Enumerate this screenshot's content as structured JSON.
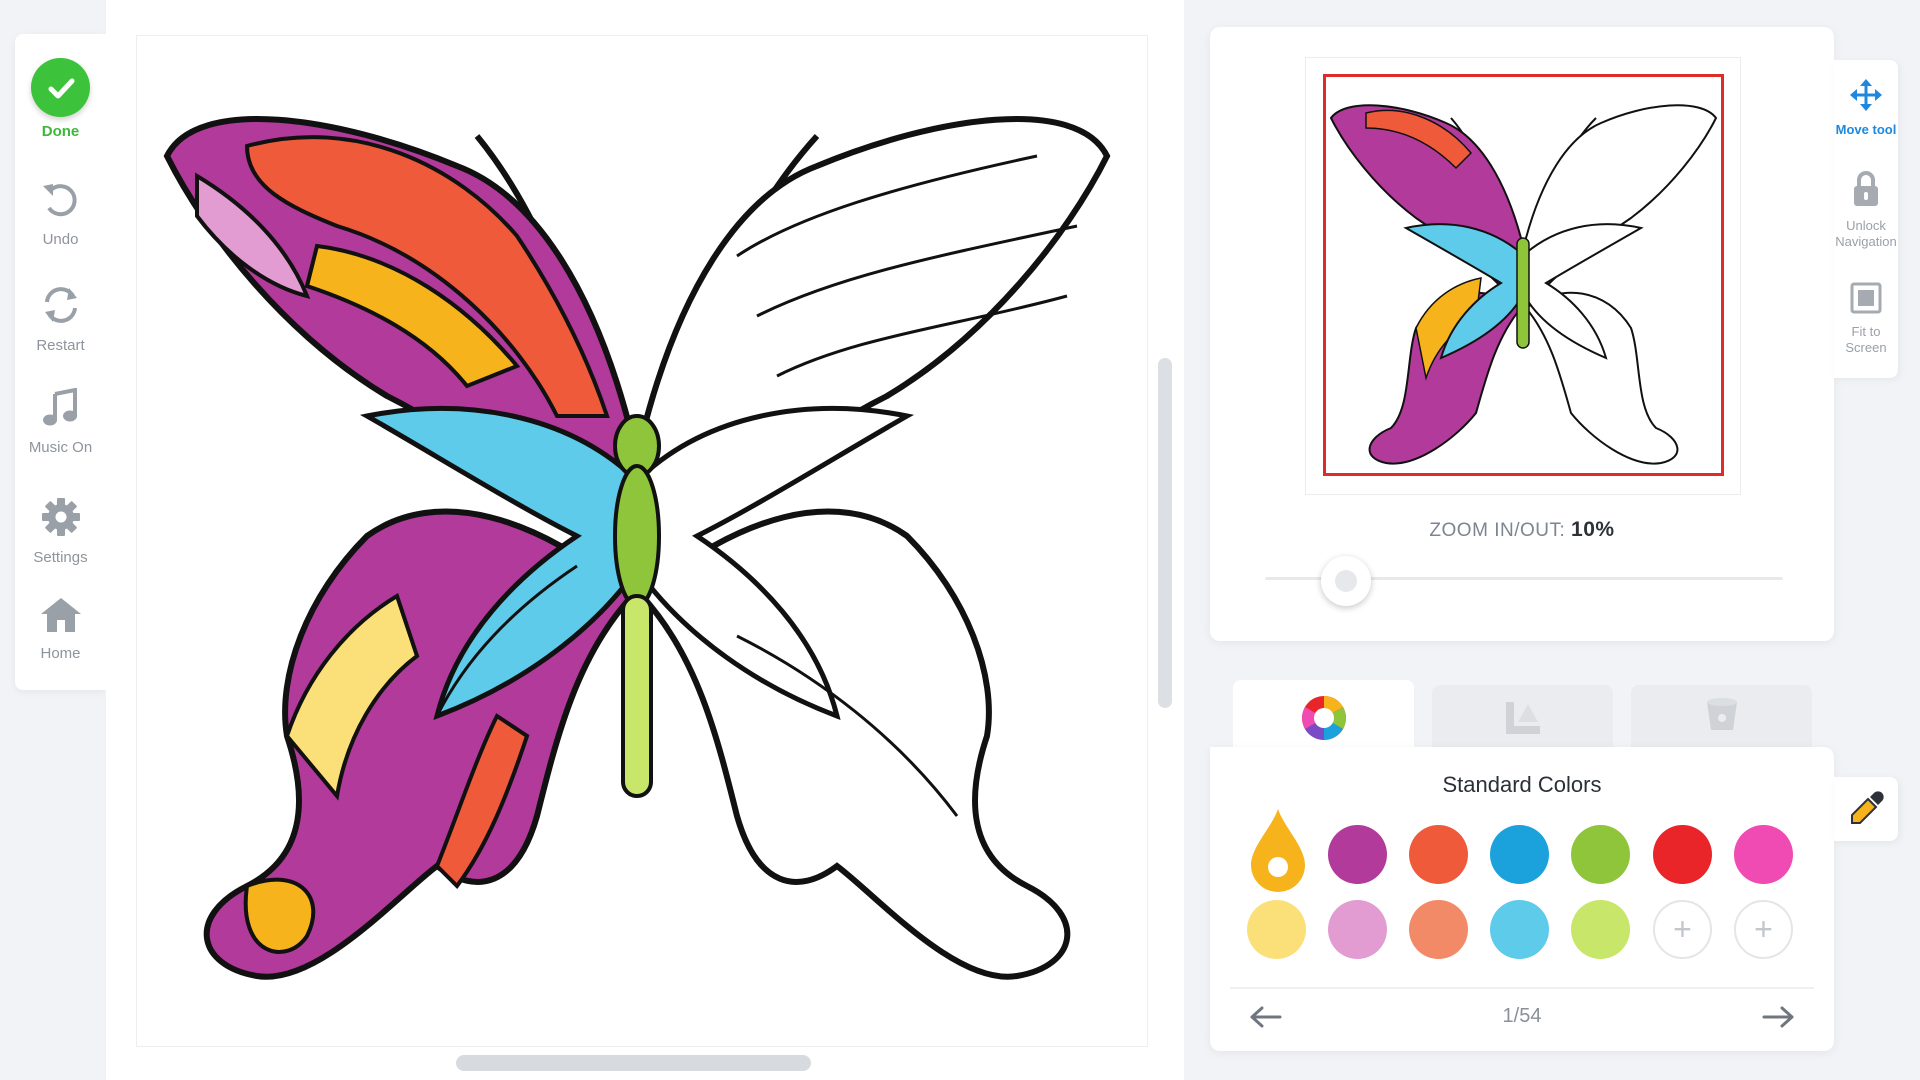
{
  "toolbar": {
    "done": "Done",
    "undo": "Undo",
    "restart": "Restart",
    "music": "Music On",
    "settings": "Settings",
    "home": "Home"
  },
  "navigator": {
    "zoom_label": "ZOOM IN/OUT:",
    "zoom_value": "10%",
    "zoom_level_percent": 10
  },
  "right_tools": {
    "move": "Move tool",
    "unlock": "Unlock Navigation",
    "fit": "Fit to Screen"
  },
  "palette": {
    "title": "Standard Colors",
    "page": "1/54",
    "swatches_row1": [
      "#f6b31c",
      "#b13a9a",
      "#ef5a3a",
      "#1ba1dc",
      "#8fc53a",
      "#e9252a",
      "#f04ab3"
    ],
    "swatches_row2": [
      "#fbe07a",
      "#e39cd2",
      "#f28a68",
      "#5ecbea",
      "#c8e66a",
      "add",
      "add"
    ]
  },
  "colors": {
    "accent_green": "#3dc23c",
    "accent_blue": "#1e88e0",
    "frame_red": "#e02b2b"
  }
}
